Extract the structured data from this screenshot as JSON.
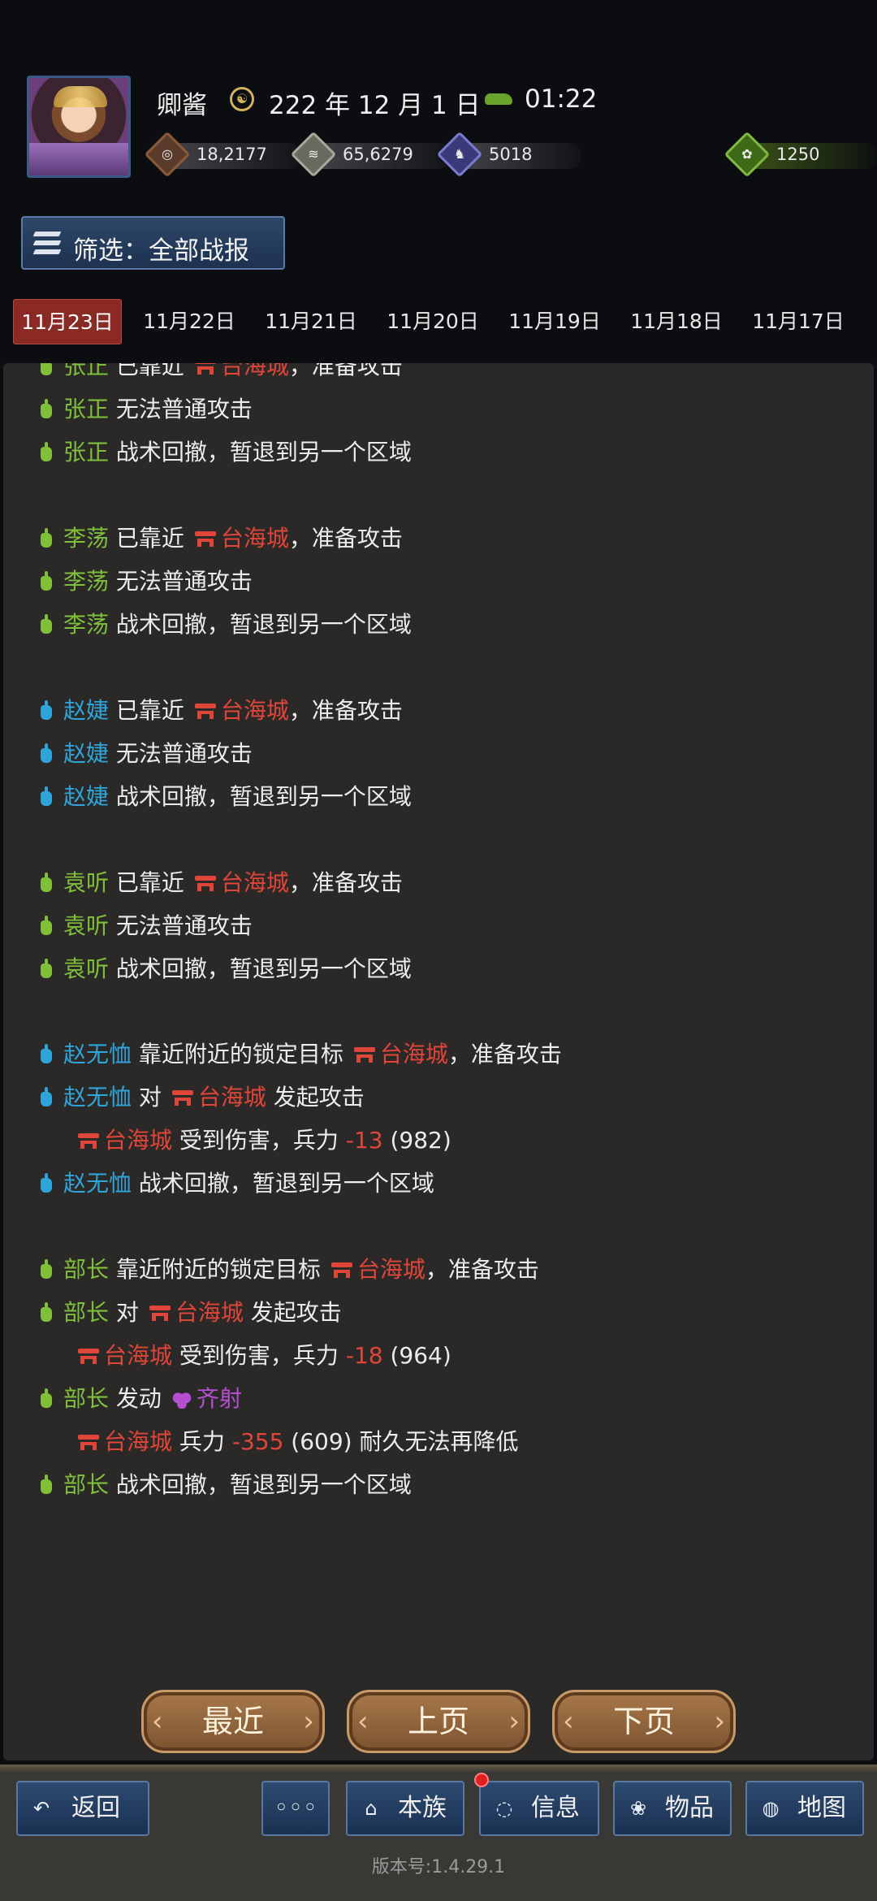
{
  "player": {
    "name": "卿酱",
    "date": "222 年 12 月 1 日",
    "time": "01:22"
  },
  "resources": {
    "money": {
      "icon": "coin-icon",
      "value": "18,2177"
    },
    "grain": {
      "icon": "grain-icon",
      "value": "65,6279"
    },
    "troops": {
      "icon": "soldier-icon",
      "value": "5018"
    },
    "jade": {
      "icon": "jade-icon",
      "value": "1250"
    }
  },
  "filter": {
    "label": "筛选：全部战报"
  },
  "date_tabs": [
    "11月23日",
    "11月22日",
    "11月21日",
    "11月20日",
    "11月19日",
    "11月18日",
    "11月17日"
  ],
  "active_tab": "11月23日",
  "log": [
    {
      "type": "name",
      "color": "green",
      "name": "张正",
      "before": "已靠近",
      "city": "台海城",
      "after": "，准备攻击"
    },
    {
      "type": "name",
      "color": "green",
      "name": "张正",
      "text": "无法普通攻击"
    },
    {
      "type": "name",
      "color": "green",
      "name": "张正",
      "text": "战术回撤，暂退到另一个区域"
    },
    {
      "type": "name",
      "color": "green",
      "name": "李荡",
      "before": "已靠近",
      "city": "台海城",
      "after": "，准备攻击"
    },
    {
      "type": "name",
      "color": "green",
      "name": "李荡",
      "text": "无法普通攻击"
    },
    {
      "type": "name",
      "color": "green",
      "name": "李荡",
      "text": "战术回撤，暂退到另一个区域"
    },
    {
      "type": "name",
      "color": "blue",
      "name": "赵婕",
      "before": "已靠近",
      "city": "台海城",
      "after": "，准备攻击"
    },
    {
      "type": "name",
      "color": "blue",
      "name": "赵婕",
      "text": "无法普通攻击"
    },
    {
      "type": "name",
      "color": "blue",
      "name": "赵婕",
      "text": "战术回撤，暂退到另一个区域"
    },
    {
      "type": "name",
      "color": "green",
      "name": "袁听",
      "before": "已靠近",
      "city": "台海城",
      "after": "，准备攻击"
    },
    {
      "type": "name",
      "color": "green",
      "name": "袁听",
      "text": "无法普通攻击"
    },
    {
      "type": "name",
      "color": "green",
      "name": "袁听",
      "text": "战术回撤，暂退到另一个区域"
    },
    {
      "type": "name",
      "color": "blue",
      "name": "赵无恤",
      "before": "靠近附近的锁定目标",
      "city": "台海城",
      "after": "，准备攻击"
    },
    {
      "type": "name",
      "color": "blue",
      "name": "赵无恤",
      "before": "对",
      "city": "台海城",
      "after": "发起攻击"
    },
    {
      "type": "city",
      "city": "台海城",
      "before": "受到伤害，兵力",
      "dmg": "-13",
      "after": "(982)"
    },
    {
      "type": "name",
      "color": "blue",
      "name": "赵无恤",
      "text": "战术回撤，暂退到另一个区域"
    },
    {
      "type": "name",
      "color": "green",
      "name": "部长",
      "before": "靠近附近的锁定目标",
      "city": "台海城",
      "after": "，准备攻击"
    },
    {
      "type": "name",
      "color": "green",
      "name": "部长",
      "before": "对",
      "city": "台海城",
      "after": "发起攻击"
    },
    {
      "type": "city",
      "city": "台海城",
      "before": "受到伤害，兵力",
      "dmg": "-18",
      "after": "(964)"
    },
    {
      "type": "name",
      "color": "green",
      "name": "部长",
      "before": "发动",
      "skill": "齐射"
    },
    {
      "type": "city",
      "city": "台海城",
      "before": "兵力",
      "dmg": "-355",
      "after": "(609) 耐久无法再降低"
    },
    {
      "type": "name",
      "color": "green",
      "name": "部长",
      "text": "战术回撤，暂退到另一个区域"
    }
  ],
  "pager": {
    "latest": "最近",
    "prev": "上页",
    "next": "下页"
  },
  "nav": {
    "back": {
      "label": "返回",
      "icon": "back-arrow-icon"
    },
    "more": {
      "label": "◦◦◦",
      "icon": "more-icon"
    },
    "clan": {
      "label": "本族",
      "icon": "clan-icon"
    },
    "info": {
      "label": "信息",
      "icon": "chat-icon"
    },
    "items": {
      "label": "物品",
      "icon": "bag-icon"
    },
    "map": {
      "label": "地图",
      "icon": "map-icon"
    }
  },
  "version": "版本号:1.4.29.1",
  "colors": {
    "green": "#7fbf3a",
    "blue": "#2fa4d8",
    "red": "#e0453a",
    "purple": "#b44fd2",
    "tab_active": "#8b2a24"
  }
}
